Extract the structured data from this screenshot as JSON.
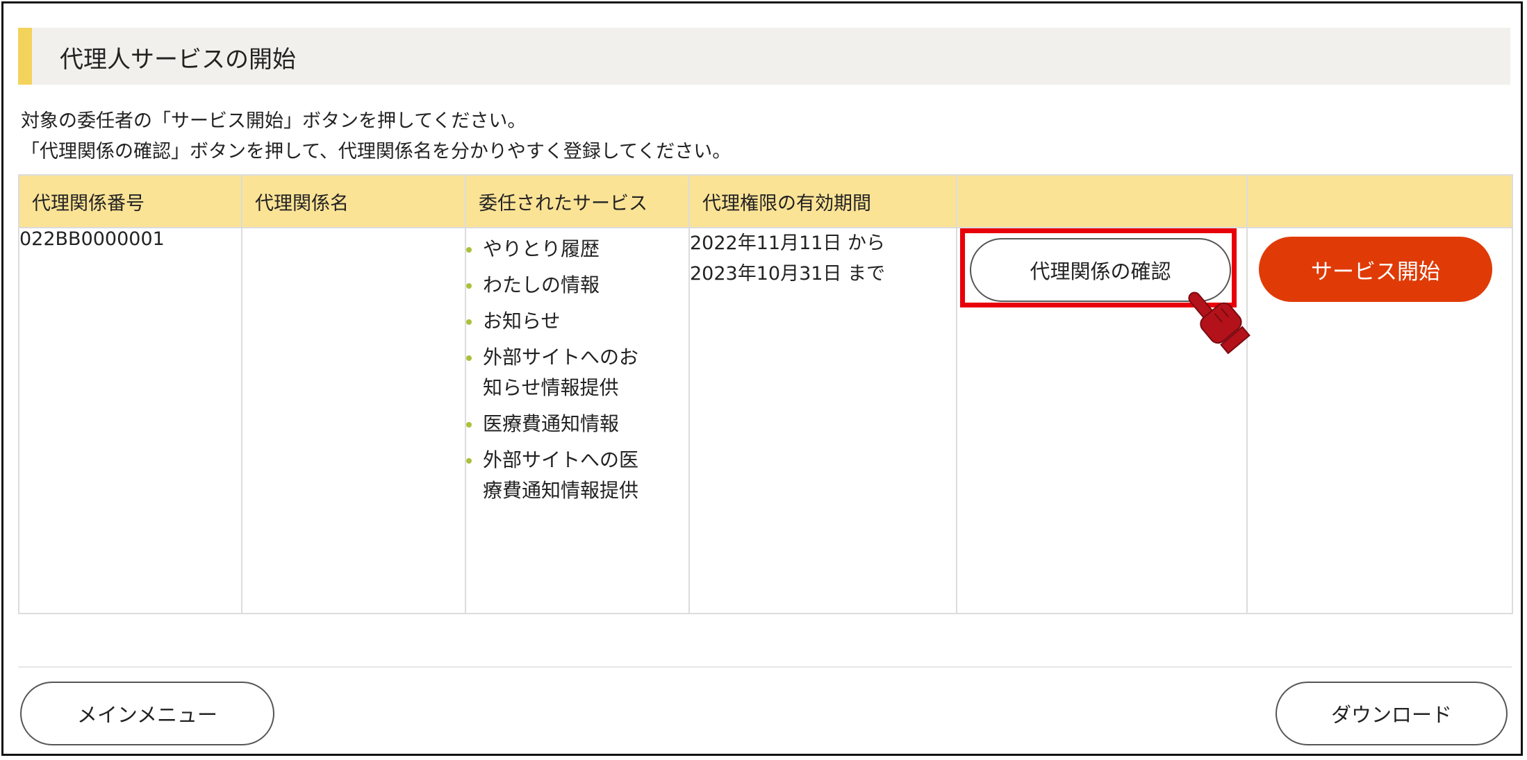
{
  "section": {
    "title": "代理人サービスの開始"
  },
  "instructions": [
    "対象の委任者の「サービス開始」ボタンを押してください。",
    "「代理関係の確認」ボタンを押して、代理関係名を分かりやすく登録してください。"
  ],
  "table": {
    "headers": [
      "代理関係番号",
      "代理関係名",
      "委任されたサービス",
      "代理権限の有効期間",
      "",
      ""
    ],
    "rows": [
      {
        "relation_number": "022BB0000001",
        "relation_name": "",
        "services": [
          "やりとり履歴",
          "わたしの情報",
          "お知らせ",
          "外部サイトへのお知らせ情報提供",
          "医療費通知情報",
          "外部サイトへの医療費通知情報提供"
        ],
        "period_from": "2022年11月11日 から",
        "period_to": "2023年10月31日 まで",
        "confirm_label": "代理関係の確認",
        "start_label": "サービス開始"
      }
    ]
  },
  "footer": {
    "main_menu_label": "メインメニュー",
    "download_label": "ダウンロード"
  },
  "colors": {
    "accent_bar": "#f3d35c",
    "header_bg": "#fbe396",
    "start_button": "#e03b06",
    "highlight": "#e8000a",
    "pointer_hand": "#b3121a",
    "bullet": "#a9c23a"
  },
  "icons": {
    "pointer": "pointing-hand-icon",
    "bullet": "bullet-dot-icon"
  }
}
